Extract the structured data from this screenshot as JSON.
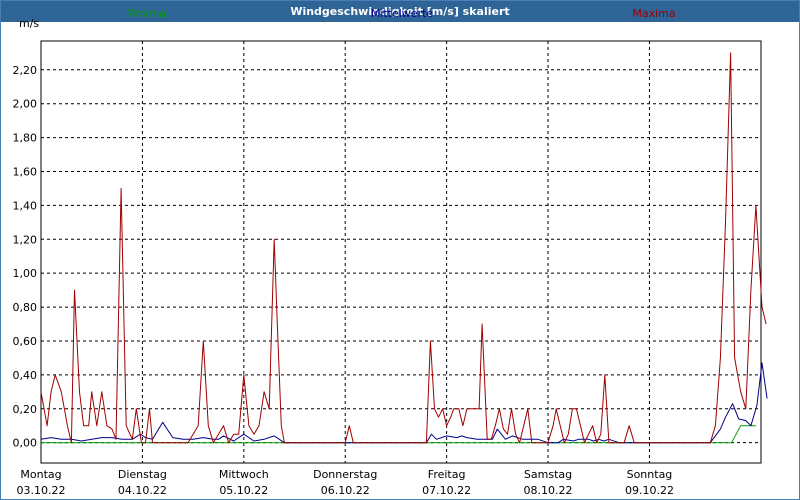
{
  "window": {
    "title": "Windgeschwindigkeit [m/s] skaliert"
  },
  "chart_data": {
    "type": "line",
    "title": "Windgeschwindigkeit [m/s] skaliert",
    "ylabel": "m/s",
    "ylim": [
      -0.12,
      2.37
    ],
    "xlim": [
      0,
      71
    ],
    "grid": true,
    "legend_position": "top",
    "y_ticks": [
      "0,00",
      "0,20",
      "0,40",
      "0,60",
      "0,80",
      "1,00",
      "1,20",
      "1,40",
      "1,60",
      "1,80",
      "2,00",
      "2,20"
    ],
    "x_tick_positions": [
      0,
      10,
      20,
      30,
      40,
      50,
      60
    ],
    "x_ticks": [
      {
        "day": "Montag",
        "date": "03.10.22"
      },
      {
        "day": "Dienstag",
        "date": "04.10.22"
      },
      {
        "day": "Mittwoch",
        "date": "05.10.22"
      },
      {
        "day": "Donnerstag",
        "date": "06.10.22"
      },
      {
        "day": "Freitag",
        "date": "07.10.22"
      },
      {
        "day": "Samstag",
        "date": "08.10.22"
      },
      {
        "day": "Sonntag",
        "date": "09.10.22"
      }
    ],
    "series": [
      {
        "name": "Minima",
        "color": "#00a000",
        "points": [
          [
            0,
            0
          ],
          [
            68.1,
            0
          ],
          [
            69,
            0.1
          ],
          [
            70.5,
            0.1
          ]
        ]
      },
      {
        "name": "Mittelwerte",
        "color": "#00008b",
        "points": [
          [
            0,
            0.02
          ],
          [
            1,
            0.03
          ],
          [
            2,
            0.02
          ],
          [
            3,
            0.02
          ],
          [
            4,
            0.01
          ],
          [
            5,
            0.02
          ],
          [
            6,
            0.03
          ],
          [
            7,
            0.03
          ],
          [
            8,
            0.02
          ],
          [
            9,
            0.02
          ],
          [
            9.8,
            0.05
          ],
          [
            10.3,
            0.03
          ],
          [
            11,
            0.02
          ],
          [
            12,
            0.12
          ],
          [
            13,
            0.03
          ],
          [
            14,
            0.02
          ],
          [
            15,
            0.02
          ],
          [
            16,
            0.03
          ],
          [
            17,
            0.02
          ],
          [
            17.5,
            0.02
          ],
          [
            18,
            0.04
          ],
          [
            19,
            0.01
          ],
          [
            20,
            0.05
          ],
          [
            21,
            0.01
          ],
          [
            22,
            0.02
          ],
          [
            23,
            0.04
          ],
          [
            24,
            0
          ],
          [
            25,
            0
          ],
          [
            26,
            0
          ],
          [
            27,
            0
          ],
          [
            28,
            0
          ],
          [
            29,
            0
          ],
          [
            30,
            0
          ],
          [
            31,
            0
          ],
          [
            32,
            0
          ],
          [
            33,
            0
          ],
          [
            34,
            0
          ],
          [
            35,
            0
          ],
          [
            36,
            0
          ],
          [
            37,
            0
          ],
          [
            38,
            0
          ],
          [
            38.5,
            0.05
          ],
          [
            39,
            0.02
          ],
          [
            40,
            0.04
          ],
          [
            41,
            0.03
          ],
          [
            41.5,
            0.04
          ],
          [
            42,
            0.03
          ],
          [
            43,
            0.02
          ],
          [
            44,
            0.02
          ],
          [
            44.5,
            0.02
          ],
          [
            45,
            0.08
          ],
          [
            45.8,
            0.02
          ],
          [
            46.5,
            0.04
          ],
          [
            47.5,
            0.02
          ],
          [
            48.5,
            0.02
          ],
          [
            49,
            0.02
          ],
          [
            50,
            0
          ],
          [
            51,
            0
          ],
          [
            51.5,
            0.02
          ],
          [
            52.5,
            0.01
          ],
          [
            53,
            0.02
          ],
          [
            54,
            0.02
          ],
          [
            54.5,
            0.01
          ],
          [
            55,
            0.02
          ],
          [
            55.5,
            0.01
          ],
          [
            56,
            0.02
          ],
          [
            57,
            0
          ],
          [
            58,
            0
          ],
          [
            59,
            0
          ],
          [
            60,
            0
          ],
          [
            61,
            0
          ],
          [
            62,
            0
          ],
          [
            63,
            0
          ],
          [
            64,
            0
          ],
          [
            65,
            0
          ],
          [
            66,
            0
          ],
          [
            67,
            0.08
          ],
          [
            67.5,
            0.15
          ],
          [
            68.2,
            0.23
          ],
          [
            68.8,
            0.14
          ],
          [
            69.5,
            0.13
          ],
          [
            70,
            0.1
          ],
          [
            70.6,
            0.22
          ],
          [
            71.1,
            0.47
          ],
          [
            71.6,
            0.26
          ]
        ]
      },
      {
        "name": "Maxima",
        "color": "#a00000",
        "points": [
          [
            0,
            0.3
          ],
          [
            0.6,
            0.1
          ],
          [
            1,
            0.3
          ],
          [
            1.4,
            0.4
          ],
          [
            2,
            0.3
          ],
          [
            2.6,
            0.1
          ],
          [
            3,
            0
          ],
          [
            3.3,
            0.9
          ],
          [
            3.8,
            0.3
          ],
          [
            4.2,
            0.1
          ],
          [
            4.7,
            0.1
          ],
          [
            5,
            0.3
          ],
          [
            5.5,
            0.1
          ],
          [
            6,
            0.3
          ],
          [
            6.5,
            0.1
          ],
          [
            7,
            0.08
          ],
          [
            7.4,
            0.02
          ],
          [
            7.9,
            1.5
          ],
          [
            8.4,
            0.1
          ],
          [
            9,
            0.02
          ],
          [
            9.4,
            0.2
          ],
          [
            9.9,
            0
          ],
          [
            10.3,
            0
          ],
          [
            10.7,
            0.2
          ],
          [
            11,
            0
          ],
          [
            12,
            0
          ],
          [
            13,
            0
          ],
          [
            14,
            0
          ],
          [
            14.5,
            0
          ],
          [
            15,
            0.05
          ],
          [
            15.5,
            0.1
          ],
          [
            16,
            0.6
          ],
          [
            16.5,
            0.1
          ],
          [
            17,
            0
          ],
          [
            17.5,
            0.05
          ],
          [
            18,
            0.1
          ],
          [
            18.5,
            0
          ],
          [
            19,
            0.05
          ],
          [
            19.5,
            0.05
          ],
          [
            20,
            0.4
          ],
          [
            20.5,
            0.1
          ],
          [
            21,
            0.05
          ],
          [
            21.5,
            0.1
          ],
          [
            22,
            0.3
          ],
          [
            22.5,
            0.2
          ],
          [
            23,
            1.2
          ],
          [
            23.3,
            0.7
          ],
          [
            23.7,
            0.1
          ],
          [
            24,
            0
          ],
          [
            25,
            0
          ],
          [
            26,
            0
          ],
          [
            27,
            0
          ],
          [
            28,
            0
          ],
          [
            29,
            0
          ],
          [
            30,
            0
          ],
          [
            30.4,
            0.1
          ],
          [
            30.8,
            0
          ],
          [
            31,
            0
          ],
          [
            32,
            0
          ],
          [
            33,
            0
          ],
          [
            34,
            0
          ],
          [
            35,
            0
          ],
          [
            36,
            0
          ],
          [
            37,
            0
          ],
          [
            38,
            0
          ],
          [
            38.4,
            0.6
          ],
          [
            38.8,
            0.2
          ],
          [
            39.2,
            0.15
          ],
          [
            39.6,
            0.2
          ],
          [
            40,
            0.1
          ],
          [
            40.4,
            0.15
          ],
          [
            40.7,
            0.2
          ],
          [
            41.2,
            0.2
          ],
          [
            41.6,
            0.1
          ],
          [
            42,
            0.2
          ],
          [
            42.8,
            0.2
          ],
          [
            43.2,
            0.2
          ],
          [
            43.5,
            0.7
          ],
          [
            44,
            0.02
          ],
          [
            44.4,
            0.02
          ],
          [
            44.8,
            0.1
          ],
          [
            45.2,
            0.2
          ],
          [
            45.6,
            0.08
          ],
          [
            46,
            0.05
          ],
          [
            46.4,
            0.2
          ],
          [
            46.8,
            0.05
          ],
          [
            47.2,
            0
          ],
          [
            47.6,
            0.1
          ],
          [
            48,
            0.2
          ],
          [
            48.4,
            0
          ],
          [
            49,
            0
          ],
          [
            50,
            0
          ],
          [
            50.5,
            0.1
          ],
          [
            50.8,
            0.2
          ],
          [
            51.2,
            0.1
          ],
          [
            51.6,
            0
          ],
          [
            52,
            0.05
          ],
          [
            52.4,
            0.2
          ],
          [
            52.8,
            0.2
          ],
          [
            53.2,
            0.1
          ],
          [
            53.6,
            0
          ],
          [
            54,
            0.05
          ],
          [
            54.4,
            0.1
          ],
          [
            54.8,
            0
          ],
          [
            55.2,
            0.05
          ],
          [
            55.6,
            0.4
          ],
          [
            56,
            0
          ],
          [
            56.4,
            0
          ],
          [
            57,
            0
          ],
          [
            57.5,
            0
          ],
          [
            58,
            0.1
          ],
          [
            58.5,
            0
          ],
          [
            59,
            0
          ],
          [
            60,
            0
          ],
          [
            61,
            0
          ],
          [
            62,
            0
          ],
          [
            63,
            0
          ],
          [
            64,
            0
          ],
          [
            65,
            0
          ],
          [
            66,
            0
          ],
          [
            66.5,
            0.1
          ],
          [
            67,
            0.5
          ],
          [
            67.5,
            1.3
          ],
          [
            68,
            2.3
          ],
          [
            68.4,
            0.5
          ],
          [
            69,
            0.3
          ],
          [
            69.5,
            0.2
          ],
          [
            70,
            0.9
          ],
          [
            70.5,
            1.4
          ],
          [
            71.1,
            0.8
          ],
          [
            71.5,
            0.7
          ]
        ]
      }
    ]
  }
}
